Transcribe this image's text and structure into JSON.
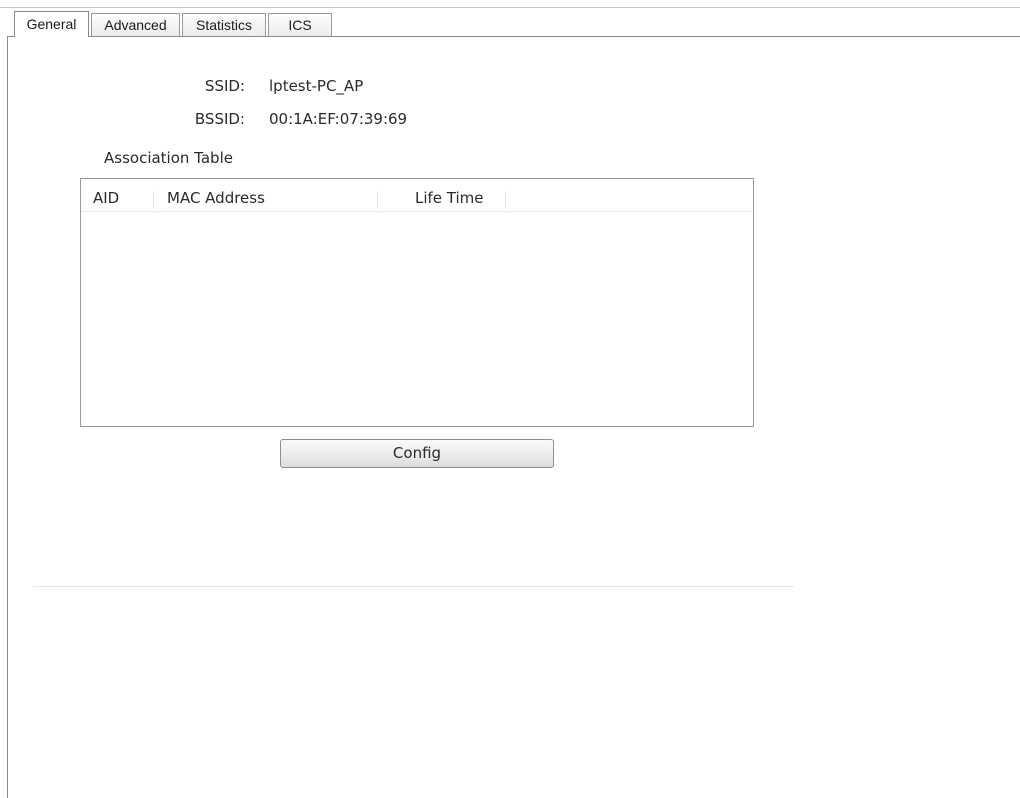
{
  "tabs": [
    {
      "label": "General",
      "active": true
    },
    {
      "label": "Advanced",
      "active": false
    },
    {
      "label": "Statistics",
      "active": false
    },
    {
      "label": "ICS",
      "active": false
    }
  ],
  "general": {
    "ssid_label": "SSID:",
    "ssid_value": "lptest-PC_AP",
    "bssid_label": "BSSID:",
    "bssid_value": "00:1A:EF:07:39:69",
    "association_table": {
      "title": "Association Table",
      "columns": [
        "AID",
        "MAC Address",
        "Life Time"
      ],
      "rows": []
    },
    "config_button": "Config"
  }
}
